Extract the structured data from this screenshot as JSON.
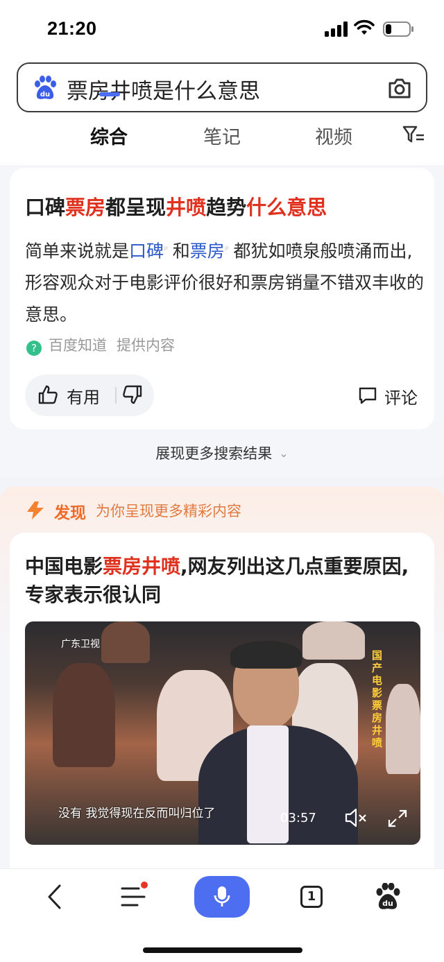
{
  "status_bar": {
    "time": "21:20"
  },
  "search": {
    "query": "票房井喷是什么意思"
  },
  "tabs": [
    {
      "label": "综合",
      "active": true
    },
    {
      "label": "笔记",
      "active": false
    },
    {
      "label": "视频",
      "active": false
    }
  ],
  "answer_card": {
    "title_parts": [
      "口碑",
      "票房",
      "都呈现",
      "井喷",
      "趋势",
      "什么意思"
    ],
    "body_parts": {
      "prefix": "简单来说就是",
      "link1": "口碑",
      "and": "和",
      "link2": "票房",
      "suffix": "都犹如喷泉般喷涌而出,形容观众对于电影评价很好和票房销量不错双丰收的意思。"
    },
    "source_name": "百度知道",
    "source_provider": "提供内容",
    "useful_label": "有用",
    "comment_label": "评论"
  },
  "more_results_label": "展现更多搜索结果",
  "discover": {
    "title": "发现",
    "subtitle": "为你呈现更多精彩内容",
    "card": {
      "title_parts": [
        "中国电影",
        "票房井喷",
        ",网友列出这几点重要原因,专家表示很认同"
      ],
      "video": {
        "channel": "广东卫视",
        "vertical_title": "国产电影票房井喷",
        "subtitle": "没有 我觉得现在反而叫归位了",
        "duration": "03:57"
      }
    }
  },
  "bottom_bar": {
    "tab_count": "1"
  },
  "colors": {
    "accent": "#4e6ef2",
    "highlight": "#e0311f",
    "link": "#2a58c8",
    "discover": "#f06a28"
  },
  "icons": [
    "baidu-paw-icon",
    "camera-icon",
    "filter-icon",
    "thumb-up-icon",
    "thumb-down-icon",
    "comment-icon",
    "lightning-icon",
    "mute-icon",
    "fullscreen-icon",
    "back-icon",
    "menu-icon",
    "mic-icon",
    "paw-icon"
  ]
}
